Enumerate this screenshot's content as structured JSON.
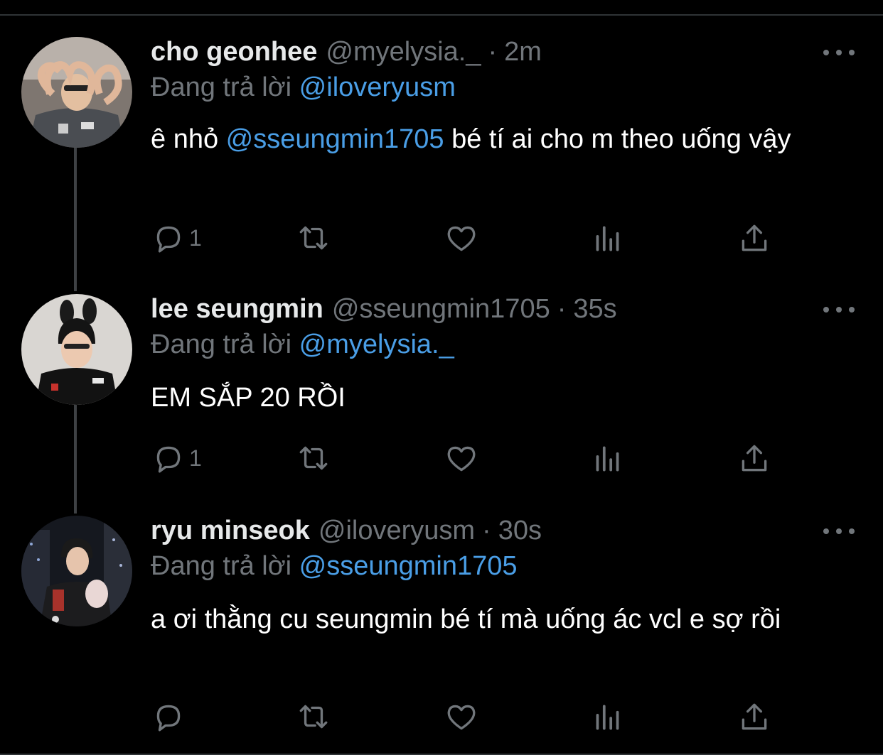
{
  "tweets": [
    {
      "name": "cho geonhee",
      "handle": "@myelysia._",
      "sep": "·",
      "time": "2m",
      "reply_prefix": "Đang trả lời",
      "reply_to": "@iloveryusm",
      "text_before": "ê nhỏ ",
      "text_mention": "@sseungmin1705",
      "text_after": " bé tí ai cho m theo uống vậy",
      "reply_count": "1",
      "avatar_icon": "avatar-heart-hands"
    },
    {
      "name": "lee seungmin",
      "handle": "@sseungmin1705",
      "sep": "·",
      "time": "35s",
      "reply_prefix": "Đang trả lời",
      "reply_to": "@myelysia._",
      "text_before": "EM SẮP 20 RỒI",
      "text_mention": "",
      "text_after": "",
      "reply_count": "1",
      "avatar_icon": "avatar-bunny-ears"
    },
    {
      "name": "ryu minseok",
      "handle": "@iloveryusm",
      "sep": "·",
      "time": "30s",
      "reply_prefix": "Đang trả lời",
      "reply_to": "@sseungmin1705",
      "text_before": "a ơi thằng cu seungmin bé tí mà uống ác vcl e sợ rồi",
      "text_mention": "",
      "text_after": "",
      "reply_count": "",
      "avatar_icon": "avatar-night-city"
    }
  ],
  "icons": {
    "more": "more-dots-icon",
    "reply": "reply-icon",
    "retweet": "retweet-icon",
    "like": "like-icon",
    "views": "views-icon",
    "share": "share-icon"
  },
  "colors": {
    "background": "#000000",
    "text": "#ffffff",
    "muted": "#71767b",
    "link": "#4a9ee6",
    "thread_line": "#3e4144"
  }
}
